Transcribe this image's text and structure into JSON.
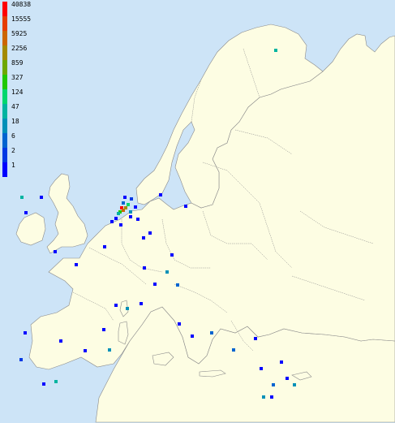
{
  "legend": {
    "labels": [
      "40838",
      "15555",
      "5925",
      "2256",
      "859",
      "327",
      "124",
      "47",
      "18",
      "6",
      "2",
      "1"
    ],
    "colors": [
      "#ff0000",
      "#e63c00",
      "#cc6600",
      "#a38a00",
      "#6da800",
      "#1fc800",
      "#00d76e",
      "#00b4a0",
      "#0090b8",
      "#0064d0",
      "#0038e4",
      "#0000ff"
    ]
  },
  "colors": {
    "sea": "#cde4f7",
    "land": "#fdfde3",
    "border": "#8a8a8a"
  },
  "density_cells": [
    {
      "lon": 4.6,
      "lat": 52.3,
      "level": 0
    },
    {
      "lon": 4.9,
      "lat": 52.1,
      "level": 2
    },
    {
      "lon": 5.2,
      "lat": 52.3,
      "level": 3
    },
    {
      "lon": 4.4,
      "lat": 52.0,
      "level": 5
    },
    {
      "lon": 5.5,
      "lat": 52.6,
      "level": 6
    },
    {
      "lon": 4.2,
      "lat": 51.8,
      "level": 7
    },
    {
      "lon": 5.8,
      "lat": 52.0,
      "level": 8
    },
    {
      "lon": 4.8,
      "lat": 52.8,
      "level": 9
    },
    {
      "lon": 6.0,
      "lat": 53.1,
      "level": 10
    },
    {
      "lon": 3.9,
      "lat": 51.4,
      "level": 11
    },
    {
      "lon": 5.9,
      "lat": 51.5,
      "level": 11
    },
    {
      "lon": 6.5,
      "lat": 52.4,
      "level": 11
    },
    {
      "lon": 5.1,
      "lat": 53.3,
      "level": 11
    },
    {
      "lon": 3.3,
      "lat": 51.1,
      "level": 11
    },
    {
      "lon": 4.5,
      "lat": 50.8,
      "level": 11
    },
    {
      "lon": 6.8,
      "lat": 51.3,
      "level": 11
    },
    {
      "lon": 8.5,
      "lat": 50.1,
      "level": 11
    },
    {
      "lon": 7.6,
      "lat": 49.6,
      "level": 11
    },
    {
      "lon": 11.5,
      "lat": 48.1,
      "level": 11
    },
    {
      "lon": 13.4,
      "lat": 52.5,
      "level": 11
    },
    {
      "lon": 10.0,
      "lat": 53.5,
      "level": 11
    },
    {
      "lon": 2.35,
      "lat": 48.86,
      "level": 11
    },
    {
      "lon": -1.6,
      "lat": 47.2,
      "level": 11
    },
    {
      "lon": -4.5,
      "lat": 48.4,
      "level": 11
    },
    {
      "lon": 5.4,
      "lat": 43.3,
      "level": 8
    },
    {
      "lon": 7.3,
      "lat": 43.7,
      "level": 11
    },
    {
      "lon": 3.9,
      "lat": 43.6,
      "level": 11
    },
    {
      "lon": 9.2,
      "lat": 45.5,
      "level": 11
    },
    {
      "lon": 10.8,
      "lat": 46.6,
      "level": 8
    },
    {
      "lon": 12.3,
      "lat": 45.4,
      "level": 9
    },
    {
      "lon": 7.7,
      "lat": 46.9,
      "level": 11
    },
    {
      "lon": 12.5,
      "lat": 41.9,
      "level": 11
    },
    {
      "lon": 14.3,
      "lat": 40.8,
      "level": 11
    },
    {
      "lon": 16.9,
      "lat": 41.1,
      "level": 9
    },
    {
      "lon": 2.2,
      "lat": 41.4,
      "level": 11
    },
    {
      "lon": 3.0,
      "lat": 39.6,
      "level": 8
    },
    {
      "lon": -3.7,
      "lat": 40.4,
      "level": 11
    },
    {
      "lon": -9.1,
      "lat": 38.7,
      "level": 10
    },
    {
      "lon": -8.6,
      "lat": 41.1,
      "level": 11
    },
    {
      "lon": -4.4,
      "lat": 36.7,
      "level": 7
    },
    {
      "lon": -6.0,
      "lat": 36.5,
      "level": 11
    },
    {
      "lon": -0.4,
      "lat": 39.5,
      "level": 11
    },
    {
      "lon": -6.3,
      "lat": 53.3,
      "level": 11
    },
    {
      "lon": -9.0,
      "lat": 53.3,
      "level": 7
    },
    {
      "lon": -8.5,
      "lat": 51.9,
      "level": 11
    },
    {
      "lon": 25.7,
      "lat": 66.5,
      "level": 7
    },
    {
      "lon": 23.7,
      "lat": 37.9,
      "level": 11
    },
    {
      "lon": 25.4,
      "lat": 36.4,
      "level": 9
    },
    {
      "lon": 24.0,
      "lat": 35.3,
      "level": 8
    },
    {
      "lon": 25.1,
      "lat": 35.3,
      "level": 11
    },
    {
      "lon": 28.2,
      "lat": 36.4,
      "level": 8
    },
    {
      "lon": 22.9,
      "lat": 40.6,
      "level": 11
    },
    {
      "lon": 27.3,
      "lat": 37.0,
      "level": 11
    },
    {
      "lon": 26.5,
      "lat": 38.5,
      "level": 11
    },
    {
      "lon": 19.9,
      "lat": 39.6,
      "level": 9
    }
  ]
}
